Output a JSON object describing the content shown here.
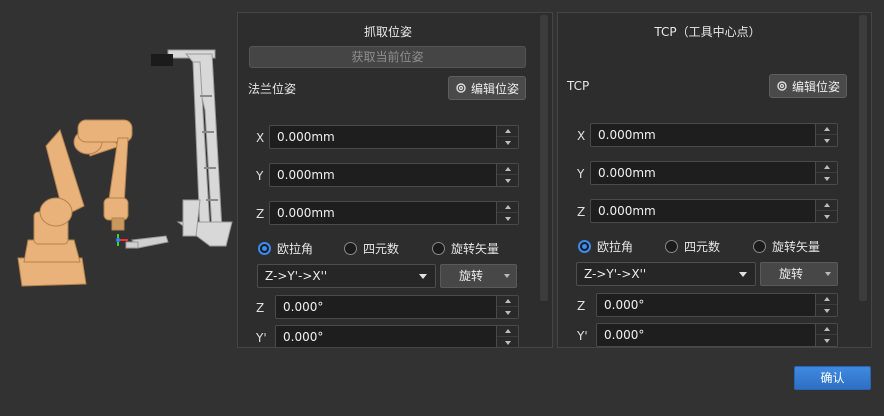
{
  "grab_panel": {
    "title": "抓取位姿",
    "get_current_pose_label": "获取当前位姿",
    "flange_pose_label": "法兰位姿",
    "edit_pose_label": "编辑位姿",
    "fields": [
      {
        "label": "X",
        "value": "0.000mm"
      },
      {
        "label": "Y",
        "value": "0.000mm"
      },
      {
        "label": "Z",
        "value": "0.000mm"
      }
    ],
    "rotation_modes": [
      "欧拉角",
      "四元数",
      "旋转矢量"
    ],
    "selected_mode": "欧拉角",
    "euler_order": "Z->Y'->X''",
    "rotation_unit": "旋转",
    "angles": [
      {
        "label": "Z",
        "value": "0.000°"
      },
      {
        "label": "Y'",
        "value": "0.000°"
      }
    ]
  },
  "tcp_panel": {
    "title": "TCP（工具中心点）",
    "tcp_label": "TCP",
    "edit_pose_label": "编辑位姿",
    "fields": [
      {
        "label": "X",
        "value": "0.000mm"
      },
      {
        "label": "Y",
        "value": "0.000mm"
      },
      {
        "label": "Z",
        "value": "0.000mm"
      }
    ],
    "rotation_modes": [
      "欧拉角",
      "四元数",
      "旋转矢量"
    ],
    "selected_mode": "欧拉角",
    "euler_order": "Z->Y'->X''",
    "rotation_unit": "旋转",
    "angles": [
      {
        "label": "Z",
        "value": "0.000°"
      },
      {
        "label": "Y'",
        "value": "0.000°"
      }
    ]
  },
  "confirm_label": "确认",
  "colors": {
    "accent": "#3a8df0",
    "robot": "#e8b27a",
    "background": "#323232"
  }
}
